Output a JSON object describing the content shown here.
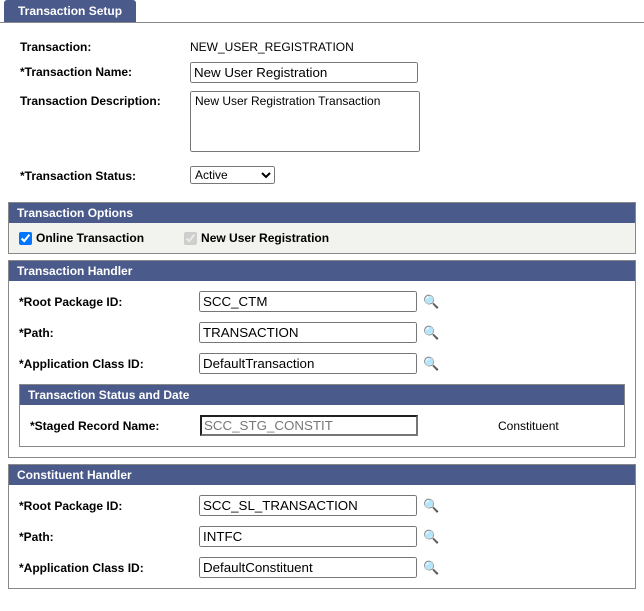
{
  "tab": {
    "label": "Transaction Setup"
  },
  "form": {
    "transaction_label": "Transaction:",
    "transaction_value": "NEW_USER_REGISTRATION",
    "name_label": "*Transaction Name:",
    "name_value": "New User Registration",
    "description_label": "Transaction Description:",
    "description_value": "New User Registration Transaction",
    "status_label": "*Transaction Status:",
    "status_value": "Active"
  },
  "options": {
    "header": "Transaction Options",
    "online_label": "Online Transaction",
    "online_checked": true,
    "newuser_label": "New User Registration",
    "newuser_checked": true
  },
  "transaction_handler": {
    "header": "Transaction Handler",
    "root_label": "*Root Package ID:",
    "root_value": "SCC_CTM",
    "path_label": "*Path:",
    "path_value": "TRANSACTION",
    "class_label": "*Application Class ID:",
    "class_value": "DefaultTransaction",
    "status_date": {
      "header": "Transaction Status and Date",
      "staged_label": "*Staged Record Name:",
      "staged_value": "SCC_STG_CONSTIT",
      "trail": "Constituent"
    }
  },
  "constituent_handler": {
    "header": "Constituent Handler",
    "root_label": "*Root Package ID:",
    "root_value": "SCC_SL_TRANSACTION",
    "path_label": "*Path:",
    "path_value": "INTFC",
    "class_label": "*Application Class ID:",
    "class_value": "DefaultConstituent"
  }
}
